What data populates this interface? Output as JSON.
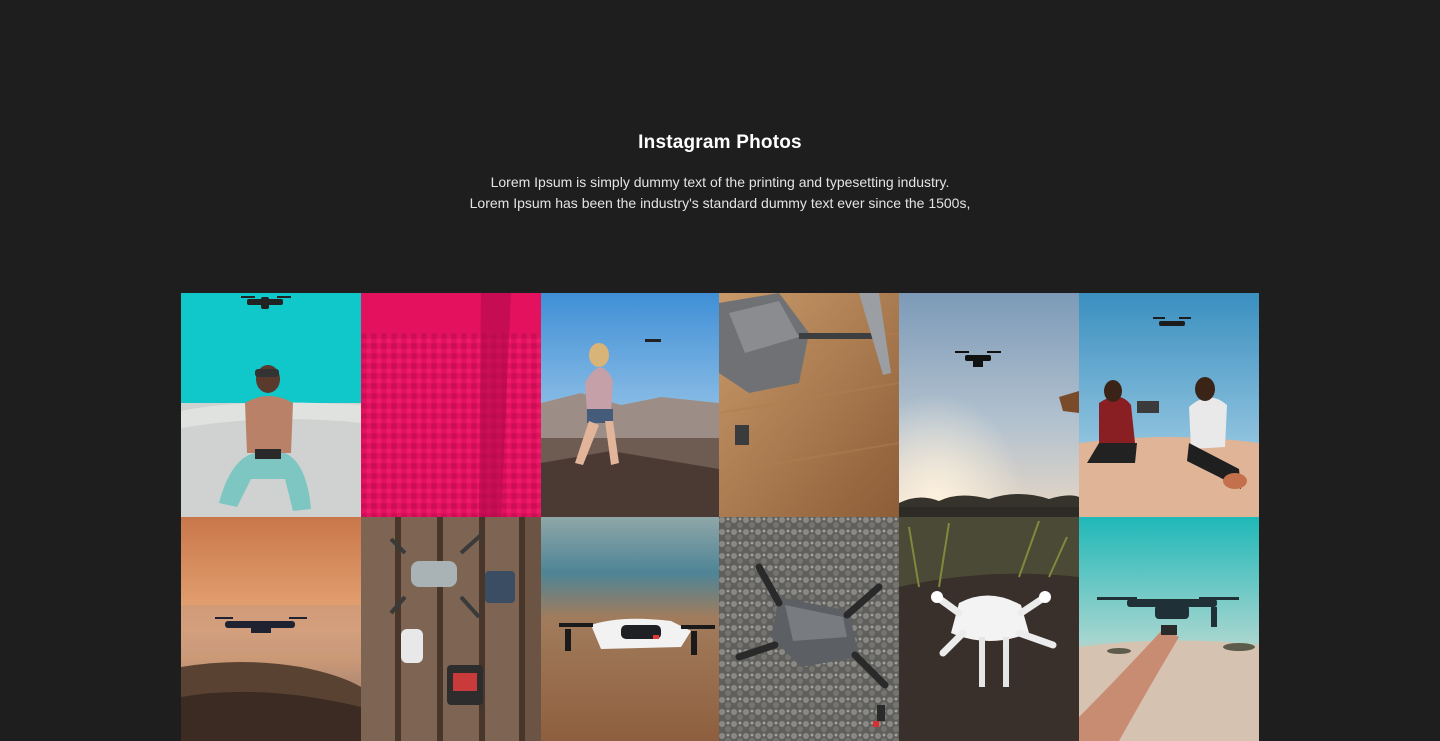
{
  "section": {
    "title": "Instagram Photos",
    "description_line1": "Lorem Ipsum is simply dummy text of the printing and typesetting industry.",
    "description_line2": "Lorem Ipsum has been the industry's standard dummy text ever since the 1500s,"
  },
  "gallery": {
    "photos": [
      {
        "icon": "drone-photo-man-sitting-desert-teal-sky"
      },
      {
        "icon": "pink-textured-photo"
      },
      {
        "icon": "drone-photo-woman-on-rocks-blue-sky"
      },
      {
        "icon": "drone-closeup-wooden-floor"
      },
      {
        "icon": "drone-silhouette-dusk-sky"
      },
      {
        "icon": "drone-photo-two-women-desert"
      },
      {
        "icon": "drone-over-sea-sunset"
      },
      {
        "icon": "drones-on-wooden-planks"
      },
      {
        "icon": "white-drone-over-beach"
      },
      {
        "icon": "drone-on-gravel"
      },
      {
        "icon": "white-drone-on-dirt"
      },
      {
        "icon": "hand-holding-drone-desert"
      }
    ]
  }
}
